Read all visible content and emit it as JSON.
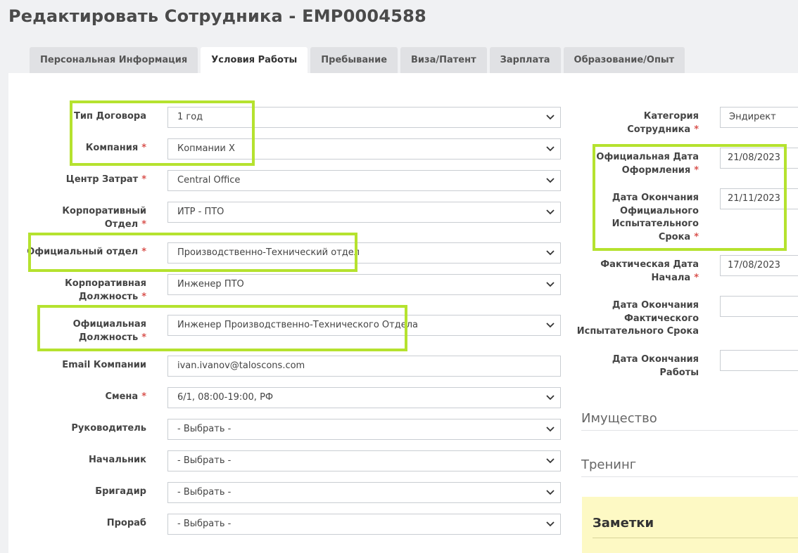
{
  "page": {
    "title": "Редактировать Сотрудника - EMP0004588"
  },
  "tabs": [
    {
      "label": "Персональная Информация",
      "active": false
    },
    {
      "label": "Условия Работы",
      "active": true
    },
    {
      "label": "Пребывание",
      "active": false
    },
    {
      "label": "Виза/Патент",
      "active": false
    },
    {
      "label": "Зарплата",
      "active": false
    },
    {
      "label": "Образование/Опыт",
      "active": false
    }
  ],
  "left_form": {
    "contract_type": {
      "label": "Тип Договора",
      "value": "1 год"
    },
    "company": {
      "label": "Компания",
      "required": "*",
      "value": "Копмании X"
    },
    "cost_center": {
      "label": "Центр Затрат",
      "required": "*",
      "value": "Central Office"
    },
    "corp_department": {
      "label_1": "Корпоративный",
      "label_2": "Отдел",
      "required": "*",
      "value": "ИТР - ПТО"
    },
    "official_department": {
      "label": "Официальный отдел",
      "required": "*",
      "value": "Производственно-Технический отдел"
    },
    "corp_position": {
      "label_1": "Корпоративная",
      "label_2": "Должность",
      "required": "*",
      "value": "Инженер ПТО"
    },
    "official_position": {
      "label_1": "Официальная",
      "label_2": "Должность",
      "required": "*",
      "value": "Инженер Производственно-Технического Отдела"
    },
    "company_email": {
      "label": "Email Компании",
      "value": "ivan.ivanov@taloscons.com"
    },
    "shift": {
      "label": "Смена",
      "required": "*",
      "value": "6/1, 08:00-19:00, РФ"
    },
    "manager": {
      "label": "Руководитель",
      "value": "- Выбрать -"
    },
    "chief": {
      "label": "Начальник",
      "value": "- Выбрать -"
    },
    "foreman": {
      "label": "Бригадир",
      "value": "- Выбрать -"
    },
    "superintendent": {
      "label": "Прораб",
      "value": "- Выбрать -"
    }
  },
  "right_form": {
    "employee_category": {
      "label_1": "Категория",
      "label_2": "Сотрудника",
      "required": "*",
      "value": "Эндирект"
    },
    "official_hire_date": {
      "label_1": "Официальная Дата",
      "label_2": "Оформления",
      "required": "*",
      "value": "21/08/2023"
    },
    "official_probation_end": {
      "label_1": "Дата Окончания",
      "label_2": "Официального",
      "label_3": "Испытательного",
      "label_4": "Срока",
      "required": "*",
      "value": "21/11/2023"
    },
    "actual_start_date": {
      "label_1": "Фактическая Дата",
      "label_2": "Начала",
      "required": "*",
      "value": "17/08/2023"
    },
    "actual_probation_end": {
      "label_1": "Дата Окончания",
      "label_2": "Фактического",
      "label_3": "Испытательного Срока",
      "value": ""
    },
    "work_end_date": {
      "label_1": "Дата Окончания",
      "label_2": "Работы",
      "value": ""
    }
  },
  "sections": {
    "property": "Имущество",
    "training": "Тренинг",
    "notes": "Заметки"
  },
  "colors": {
    "highlight": "#b5e22f",
    "required": "#d9534f",
    "notes_bg": "#fdf9c4"
  },
  "icons": {
    "dropdown": "chevron-down-icon"
  }
}
